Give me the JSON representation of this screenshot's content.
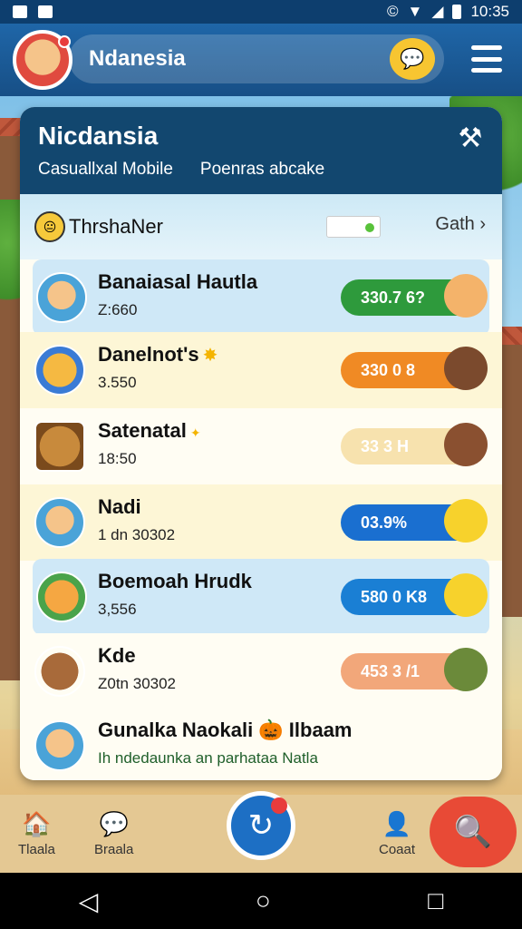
{
  "status_bar": {
    "time": "10:35"
  },
  "app_bar": {
    "title": "Ndanesia"
  },
  "card": {
    "title": "Nicdansia",
    "subtitle_left": "Casuallxal Mobile",
    "subtitle_right": "Poenras abcake",
    "filter": {
      "label": "ThrshaNer",
      "action": "Gath"
    },
    "rows": [
      {
        "name": "Banaiasal Hautla",
        "sub": "Z:660",
        "badge": "330.7 6?",
        "badge_color": "#2e9a3c",
        "style": "blue"
      },
      {
        "name": "Danelnot's",
        "sub": "3.550",
        "badge": "330 0 8",
        "badge_color": "#f08a24",
        "style": "cream"
      },
      {
        "name": "Satenatal",
        "sub": "18:50",
        "badge": "33 3 H",
        "badge_color": "#f7e2ae",
        "style": "white"
      },
      {
        "name": "Nadi",
        "sub": "1 dn 30302",
        "badge": "03.9%",
        "badge_color": "#1a6fd0",
        "style": "cream"
      },
      {
        "name": "Boemoah Hrudk",
        "sub": "3,556",
        "badge": "580 0 K8",
        "badge_color": "#1a7fd4",
        "style": "blue"
      },
      {
        "name": "Kde",
        "sub": "Z0tn 30302",
        "badge": "453 3 /1",
        "badge_color": "#f2a77a",
        "style": "white"
      },
      {
        "name": "Gunalka Naokali 🎃 Ilbaam",
        "sub": "Ih ndedaunka an parhataa Natla",
        "badge": "",
        "badge_color": "",
        "style": "white"
      }
    ]
  },
  "bottom_nav": {
    "left_label": "Tlaala",
    "second_label": "Braala",
    "right_label": "Coaat"
  }
}
